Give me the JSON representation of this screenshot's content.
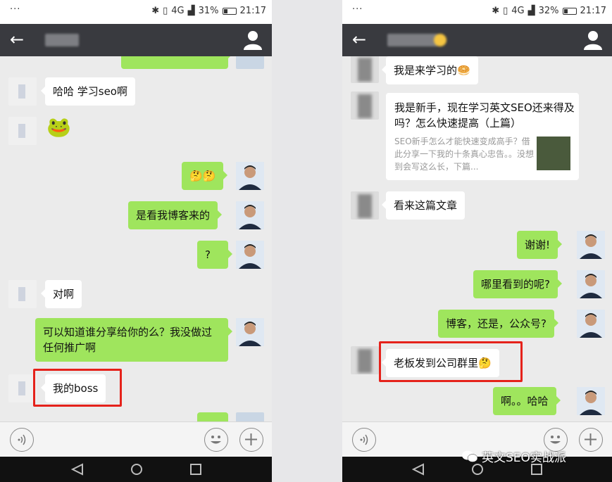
{
  "left": {
    "status": {
      "dots": "···",
      "network": "4G",
      "battery": "31%",
      "time": "21:17"
    },
    "messages": [
      {
        "side": "in",
        "text": "哈哈 学习seo啊"
      },
      {
        "side": "in",
        "text": "🐸"
      },
      {
        "side": "out",
        "text": "🤔🤔"
      },
      {
        "side": "out",
        "text": "是看我博客来的"
      },
      {
        "side": "out",
        "text": "?"
      },
      {
        "side": "in",
        "text": "对啊"
      },
      {
        "side": "out",
        "text": "可以知道谁分享给你的么？我没做过任何推广啊"
      },
      {
        "side": "in",
        "text": "我的boss"
      }
    ]
  },
  "right": {
    "status": {
      "dots": "···",
      "network": "4G",
      "battery": "32%",
      "time": "21:17"
    },
    "messages": [
      {
        "side": "in",
        "text": "我是来学习的🥯"
      },
      {
        "side": "in",
        "card_title": "我是新手，现在学习英文SEO还来得及吗？怎么快速提高（上篇）",
        "card_desc": "SEO新手怎么才能快速变成高手？借此分享一下我的十条真心忠告。。没想到会写这么长，下篇..."
      },
      {
        "side": "in",
        "text": "看来这篇文章"
      },
      {
        "side": "out",
        "text": "谢谢!"
      },
      {
        "side": "out",
        "text": "哪里看到的呢?"
      },
      {
        "side": "out",
        "text": "博客，还是，公众号?"
      },
      {
        "side": "in",
        "text": "老板发到公司群里🤔"
      },
      {
        "side": "out",
        "text": "啊。。哈哈"
      }
    ]
  },
  "watermark": "英文SEO实战派",
  "colors": {
    "titlebar": "#393a3f",
    "out_bubble": "#9fe55d",
    "highlight": "#e5221b"
  }
}
